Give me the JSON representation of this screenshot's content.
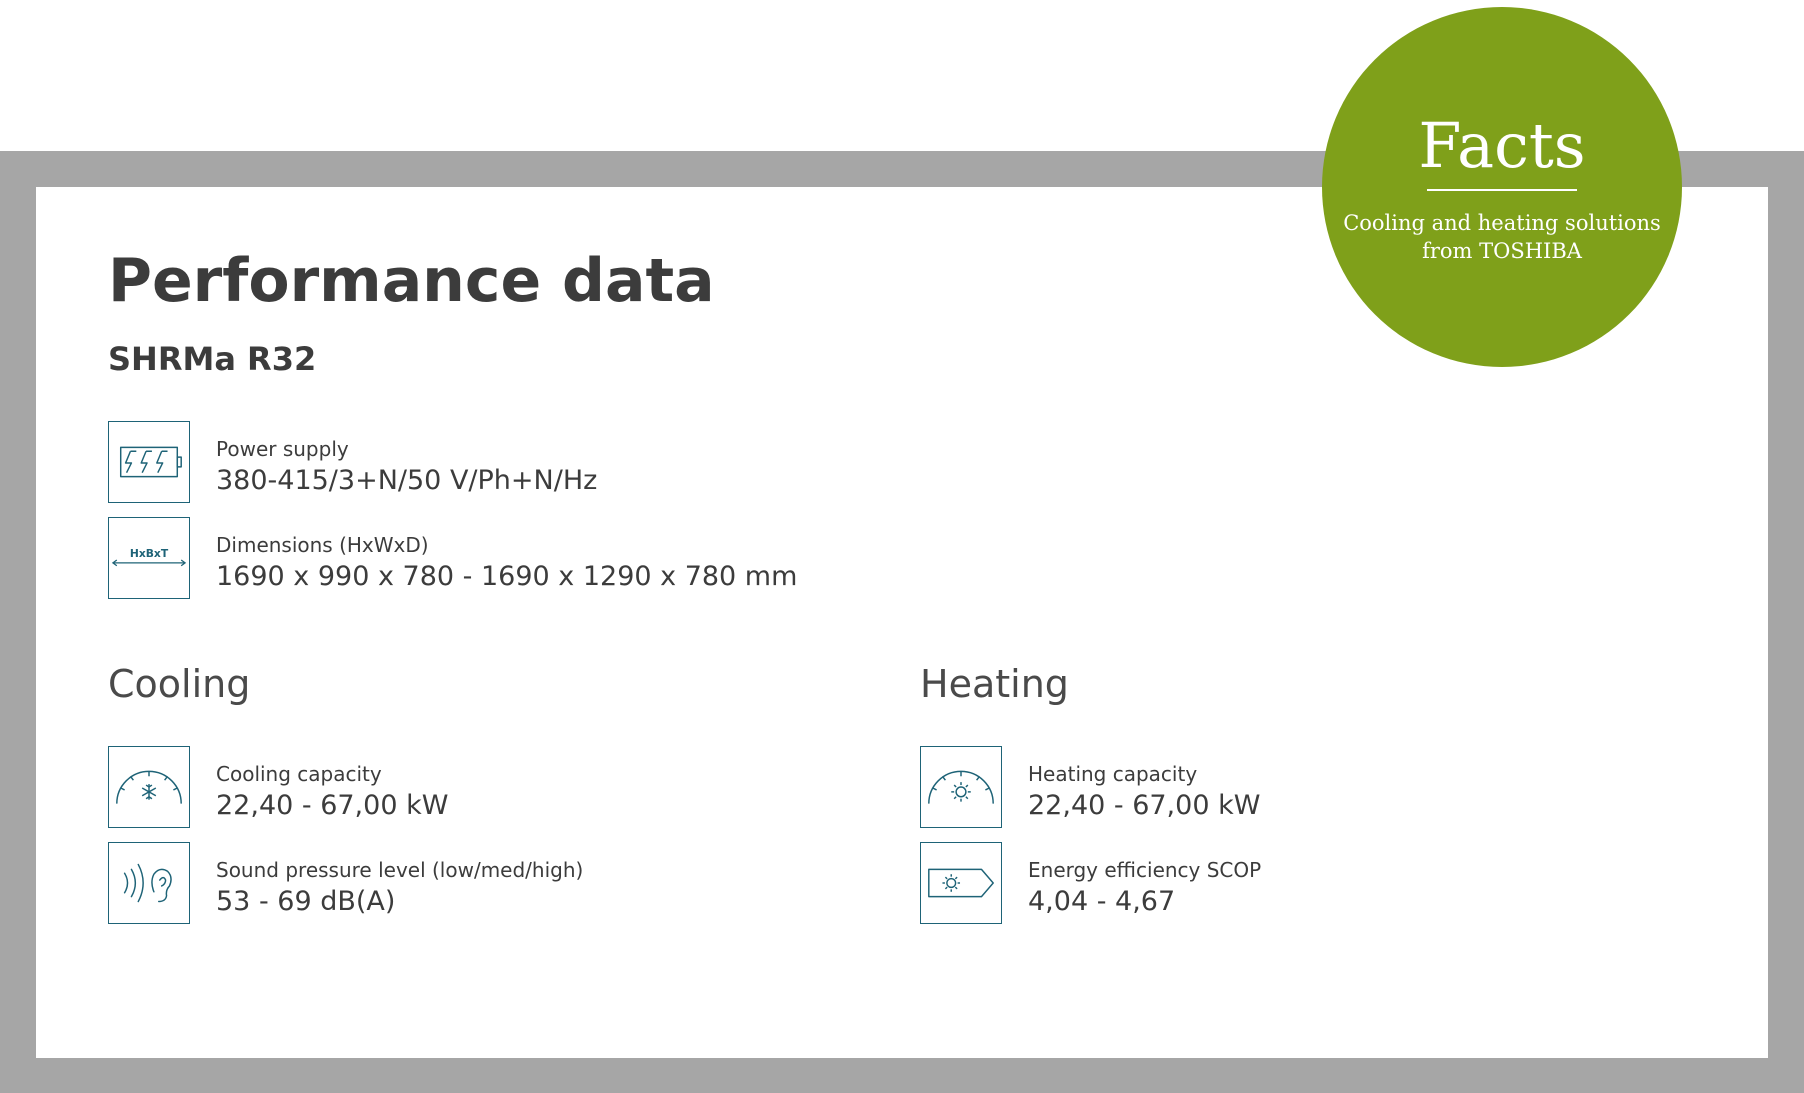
{
  "page": {
    "title": "Performance data",
    "model": "SHRMa R32"
  },
  "badge": {
    "title": "Facts",
    "subtitle": "Cooling and heating solutions from TOSHIBA"
  },
  "general_specs": [
    {
      "icon": "power-supply-icon",
      "label": "Power supply",
      "value": "380-415/3+N/50 V/Ph+N/Hz"
    },
    {
      "icon": "dimensions-icon",
      "icon_text": "HxBxT",
      "label": "Dimensions (HxWxD)",
      "value": "1690 x 990 x 780 - 1690 x 1290 x 780 mm"
    }
  ],
  "cooling": {
    "title": "Cooling",
    "specs": [
      {
        "icon": "cooling-capacity-gauge-icon",
        "label": "Cooling capacity",
        "value": "22,40 - 67,00 kW"
      },
      {
        "icon": "sound-pressure-ear-icon",
        "label": "Sound pressure level (low/med/high)",
        "value": "53 - 69 dB(A)"
      }
    ]
  },
  "heating": {
    "title": "Heating",
    "specs": [
      {
        "icon": "heating-capacity-gauge-icon",
        "label": "Heating capacity",
        "value": "22,40 - 67,00 kW"
      },
      {
        "icon": "energy-efficiency-label-icon",
        "label": "Energy efficiency SCOP",
        "value": "4,04 - 4,67"
      }
    ]
  },
  "colors": {
    "accent_green": "#7fa01a",
    "icon_teal": "#1e6377",
    "frame_gray": "#a6a6a6",
    "text_dark": "#3c3c3c"
  }
}
